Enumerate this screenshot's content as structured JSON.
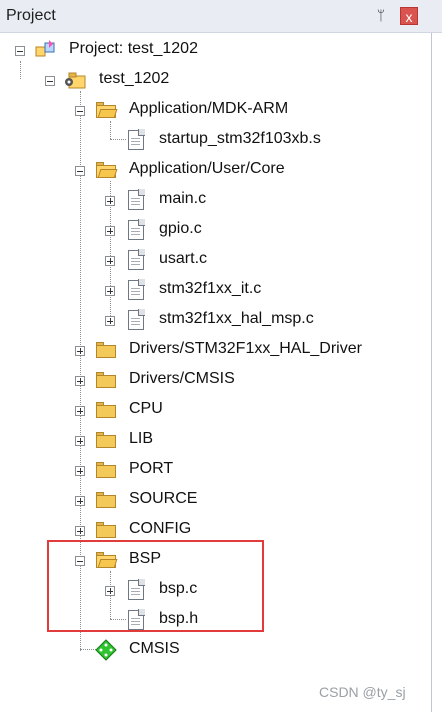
{
  "panel": {
    "title": "Project",
    "pin_label": "ᛘ",
    "close_label": "x"
  },
  "tree": {
    "project": "Project: test_1202",
    "target": "test_1202",
    "groups": [
      {
        "name": "Application/MDK-ARM",
        "expanded": true,
        "files": [
          "startup_stm32f103xb.s"
        ]
      },
      {
        "name": "Application/User/Core",
        "expanded": true,
        "files": [
          "main.c",
          "gpio.c",
          "usart.c",
          "stm32f1xx_it.c",
          "stm32f1xx_hal_msp.c"
        ]
      },
      {
        "name": "Drivers/STM32F1xx_HAL_Driver",
        "expanded": false
      },
      {
        "name": "Drivers/CMSIS",
        "expanded": false
      },
      {
        "name": "CPU",
        "expanded": false
      },
      {
        "name": "LIB",
        "expanded": false
      },
      {
        "name": "PORT",
        "expanded": false
      },
      {
        "name": "SOURCE",
        "expanded": false
      },
      {
        "name": "CONFIG",
        "expanded": false
      },
      {
        "name": "BSP",
        "expanded": true,
        "files": [
          "bsp.c",
          "bsp.h"
        ]
      }
    ],
    "cmsis_component": "CMSIS"
  },
  "watermark": "CSDN @ty_sj",
  "colors": {
    "folder": "#f3c95a",
    "highlight_box": "#e23b3b",
    "titlebar": "#e9edf3",
    "close_button": "#d9534f"
  },
  "icons": {
    "project": "project-icon",
    "target": "target-icon",
    "folder": "folder-icon",
    "file": "file-icon",
    "component": "green-diamond-icon"
  }
}
